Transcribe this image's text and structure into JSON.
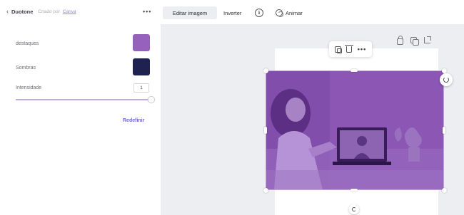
{
  "header": {
    "back_title": "Duotone",
    "credit_prefix": "Criado por",
    "credit_author": "Canva",
    "more": "•••",
    "edit_image": "Editar imagem",
    "invert": "Inverter",
    "info": "i",
    "animate": "Animar"
  },
  "panel": {
    "highlights_label": "destaques",
    "highlights_color": "#9660bd",
    "shadows_label": "Sombras",
    "shadows_color": "#1f2151",
    "intensity_label": "Intensidade",
    "intensity_value": "1",
    "intensity_slider": 1.0,
    "reset_label": "Redefinir",
    "accent_color": "#c3a8e6"
  },
  "canvas": {
    "more": "•••",
    "image_base_color": "#8c58b3"
  }
}
